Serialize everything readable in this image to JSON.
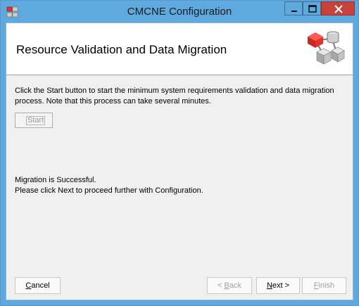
{
  "window": {
    "title": "CMCNE Configuration",
    "controls": {
      "minimize": "minimize",
      "maximize": "maximize",
      "close": "close"
    }
  },
  "header": {
    "title": "Resource Validation and Data Migration",
    "logo_icon": "network-nodes-icon"
  },
  "content": {
    "description": "Click the Start button to start the minimum system requirements validation and data migration process. Note that this process can take several minutes.",
    "start_button": {
      "label": "Start",
      "enabled": false
    },
    "status_line1": "Migration is Successful.",
    "status_line2": "Please click Next to proceed further with Configuration."
  },
  "footer": {
    "cancel": {
      "first": "C",
      "rest": "ancel",
      "enabled": true
    },
    "back": {
      "prefix": "< ",
      "first": "B",
      "rest": "ack",
      "enabled": false
    },
    "next": {
      "first": "N",
      "rest": "ext >",
      "enabled": true
    },
    "finish": {
      "first": "F",
      "rest": "inish",
      "enabled": false
    }
  },
  "colors": {
    "title_bar": "#5ea9dd",
    "close_button": "#c7423a",
    "client_background": "#f0f0f0",
    "logo_red": "#e0322e",
    "logo_gray": "#9a9a9a"
  }
}
